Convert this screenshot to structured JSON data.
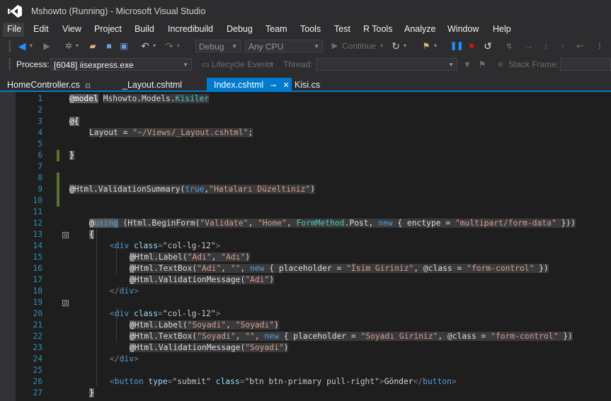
{
  "window": {
    "title": "Mshowto (Running) - Microsoft Visual Studio"
  },
  "menu": {
    "items": [
      {
        "label": "File"
      },
      {
        "label": "Edit"
      },
      {
        "label": "View"
      },
      {
        "label": "Project"
      },
      {
        "label": "Build"
      },
      {
        "label": "Incredibuild"
      },
      {
        "label": "Debug"
      },
      {
        "label": "Team"
      },
      {
        "label": "Tools"
      },
      {
        "label": "Test"
      },
      {
        "label": "R Tools"
      },
      {
        "label": "Analyze"
      },
      {
        "label": "Window"
      },
      {
        "label": "Help"
      }
    ]
  },
  "toolbar": {
    "configuration": "Debug",
    "platform": "Any CPU",
    "continue_label": "Continue",
    "process_label": "Process:",
    "process_value": "[6048] iisexpress.exe",
    "lifecycle_label": "Lifecycle Events",
    "thread_label": "Thread:",
    "thread_value": "",
    "stackframe_label": "Stack Frame:",
    "stackframe_value": ""
  },
  "tabs": [
    {
      "label": "HomeController.cs",
      "pin": "⊡",
      "active": false
    },
    {
      "label": "_Layout.cshtml",
      "active": false
    },
    {
      "label": "Index.cshtml",
      "pin": "⊸",
      "close": "✕",
      "active": true
    },
    {
      "label": "Kisi.cs",
      "active": false
    }
  ],
  "editor": {
    "line_numbers": [
      "1",
      "2",
      "3",
      "4",
      "5",
      "6",
      "7",
      "8",
      "9",
      "10",
      "11",
      "12",
      "13",
      "14",
      "15",
      "16",
      "17",
      "18",
      "19",
      "20",
      "21",
      "22",
      "23",
      "24",
      "25",
      "26",
      "27"
    ],
    "lines": {
      "l1": {
        "at": "@",
        "model": "model",
        "ns": "Mshowto.Models.",
        "type": "Kisiler"
      },
      "l3": {
        "open": "@{"
      },
      "l4": {
        "text": "Layout = ",
        "value": "\"~/Views/_Layout.cshtml\"",
        "end": ";"
      },
      "l6": {
        "close": "}"
      },
      "l9": {
        "at": "@",
        "call": "Html.ValidationSummary(",
        "kw": "true",
        "comma": ",",
        "str": "\"Hataları Düzeltiniz\"",
        "end": ")"
      },
      "l12": {
        "at": "@",
        "kw": "using",
        "p1": " (Html.BeginForm(",
        "s1": "\"Validate\"",
        "c1": ", ",
        "s2": "\"Home\"",
        "c2": ", ",
        "type": "FormMethod",
        "p2": ".Post, ",
        "kw2": "new",
        "p3": " { enctype = ",
        "s3": "\"multipart/form-data\"",
        "end": " }))"
      },
      "l13": {
        "text": "{"
      },
      "l14": {
        "lt": "<",
        "tag": "div",
        "attr": " class",
        "eq": "=",
        "val": "\"col-lg-12\"",
        "gt": ">"
      },
      "l15": {
        "at": "@",
        "call": "Html.Label(",
        "s1": "\"Adi\"",
        "c": ", ",
        "s2": "\"Adı\"",
        "end": ")"
      },
      "l16": {
        "at": "@",
        "call": "Html.TextBox(",
        "s1": "\"Adi\"",
        "c1": ", ",
        "s2": "\"\"",
        "c2": ", ",
        "kw": "new",
        "p1": " { placeholder = ",
        "s3": "\"İsim Giriniz\"",
        "p2": ", @class = ",
        "s4": "\"form-control\"",
        "end": " })"
      },
      "l17": {
        "at": "@",
        "call": "Html.ValidationMessage(",
        "s1": "\"Adi\"",
        "end": ")"
      },
      "l18": {
        "lt": "</",
        "tag": "div",
        "gt": ">"
      },
      "l20": {
        "lt": "<",
        "tag": "div",
        "attr": " class",
        "eq": "=",
        "val": "\"col-lg-12\"",
        "gt": ">"
      },
      "l21": {
        "at": "@",
        "call": "Html.Label(",
        "s1": "\"Soyadi\"",
        "c": ", ",
        "s2": "\"Soyadı\"",
        "end": ")"
      },
      "l22": {
        "at": "@",
        "call": "Html.TextBox(",
        "s1": "\"Soyadi\"",
        "c1": ", ",
        "s2": "\"\"",
        "c2": ", ",
        "kw": "new",
        "p1": " { placeholder = ",
        "s3": "\"Soyadı Giriniz\"",
        "p2": ", @class = ",
        "s4": "\"form-control\"",
        "end": " })"
      },
      "l23": {
        "at": "@",
        "call": "Html.ValidationMessage(",
        "s1": "\"Soyadi\"",
        "end": ")"
      },
      "l24": {
        "lt": "</",
        "tag": "div",
        "gt": ">"
      },
      "l26": {
        "lt": "<",
        "tag": "button",
        "a1": " type",
        "eq1": "=",
        "v1": "\"submit\"",
        "a2": " class",
        "eq2": "=",
        "v2": "\"btn btn-primary pull-right\"",
        "gt": ">",
        "text": "Gönder",
        "clt": "</",
        "ctag": "button",
        "cgt": ">"
      },
      "l27": {
        "text": "}"
      }
    }
  },
  "colors": {
    "accent": "#007acc",
    "background": "#1e1e1e",
    "chrome": "#2d2d30",
    "line_number": "#2b91af",
    "change_marker": "#577430"
  },
  "icons": {
    "logo": "visual-studio-logo",
    "fold": "⊟"
  }
}
